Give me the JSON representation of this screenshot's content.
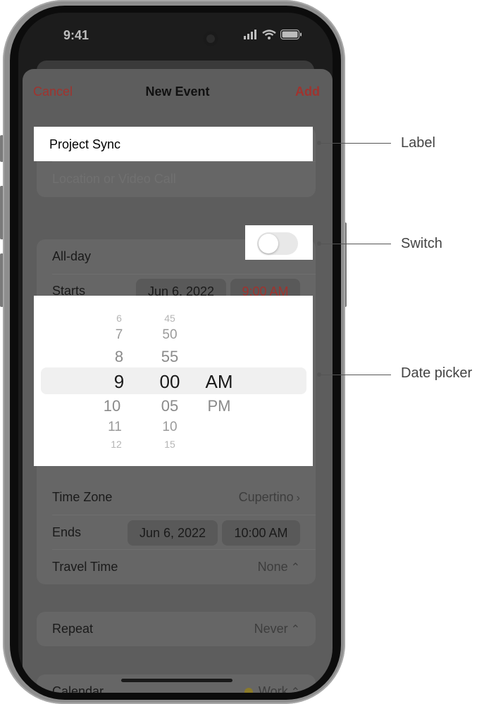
{
  "status": {
    "time": "9:41"
  },
  "nav": {
    "cancel": "Cancel",
    "title": "New Event",
    "add": "Add"
  },
  "event": {
    "title_value": "Project Sync",
    "location_placeholder": "Location or Video Call"
  },
  "allday": {
    "label": "All-day",
    "on": false
  },
  "starts": {
    "label": "Starts",
    "date": "Jun 6, 2022",
    "time": "9:00 AM"
  },
  "picker": {
    "hours": [
      "6",
      "7",
      "8",
      "9",
      "10",
      "11",
      "12"
    ],
    "minutes": [
      "45",
      "50",
      "55",
      "00",
      "05",
      "10",
      "15"
    ],
    "periods": [
      "AM",
      "PM"
    ],
    "selected": {
      "hour": "9",
      "minute": "00",
      "period": "AM"
    }
  },
  "timezone": {
    "label": "Time Zone",
    "value": "Cupertino"
  },
  "ends": {
    "label": "Ends",
    "date": "Jun 6, 2022",
    "time": "10:00 AM"
  },
  "travel": {
    "label": "Travel Time",
    "value": "None"
  },
  "repeat": {
    "label": "Repeat",
    "value": "Never"
  },
  "calendar": {
    "label": "Calendar",
    "value": "Work",
    "dot_color": "#c9a227"
  },
  "annotations": {
    "label": "Label",
    "switch": "Switch",
    "date_picker": "Date picker"
  },
  "colors": {
    "accent": "#a0332e"
  }
}
